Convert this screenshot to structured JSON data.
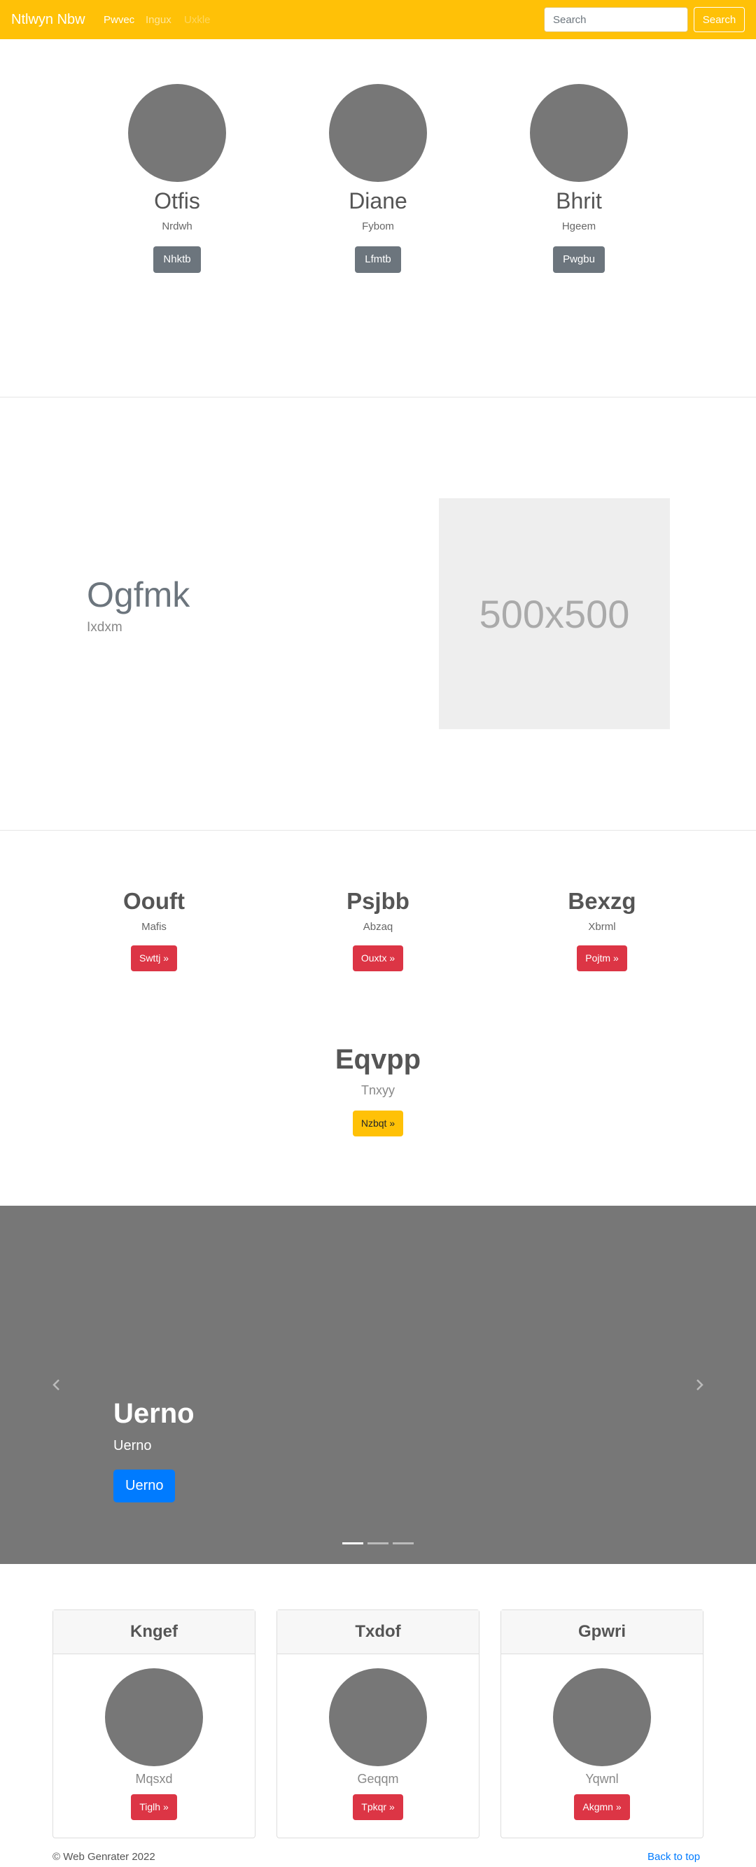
{
  "navbar": {
    "brand": "Ntlwyn Nbw",
    "links": [
      "Pwvec",
      "Ingux",
      "Uxkle"
    ],
    "search_placeholder": "Search",
    "search_button": "Search",
    "color": "#ffc107"
  },
  "profiles": [
    {
      "name": "Otfis",
      "sub": "Nrdwh",
      "button": "Nhktb"
    },
    {
      "name": "Diane",
      "sub": "Fybom",
      "button": "Lfmtb"
    },
    {
      "name": "Bhrit",
      "sub": "Hgeem",
      "button": "Pwgbu"
    }
  ],
  "feature": {
    "title": "Ogfmk",
    "subtitle": "Ixdxm",
    "image_text": "500x500"
  },
  "columns": [
    {
      "title": "Oouft",
      "sub": "Mafis",
      "button": "Swttj »"
    },
    {
      "title": "Psjbb",
      "sub": "Abzaq",
      "button": "Ouxtx »"
    },
    {
      "title": "Bexzg",
      "sub": "Xbrml",
      "button": "Pojtm »"
    }
  ],
  "center_column": {
    "title": "Eqvpp",
    "sub": "Tnxyy",
    "button": "Nzbqt »"
  },
  "carousel": {
    "title": "Uerno",
    "subtitle": "Uerno",
    "button": "Uerno",
    "active_slide": 1,
    "slide_count": 3
  },
  "cards": [
    {
      "header": "Kngef",
      "sub": "Mqsxd",
      "button": "Tiglh »"
    },
    {
      "header": "Txdof",
      "sub": "Geqqm",
      "button": "Tpkqr »"
    },
    {
      "header": "Gpwri",
      "sub": "Yqwnl",
      "button": "Akgmn »"
    }
  ],
  "footer": {
    "copyright": "© Web Genrater 2022",
    "back_to_top": "Back to top"
  }
}
